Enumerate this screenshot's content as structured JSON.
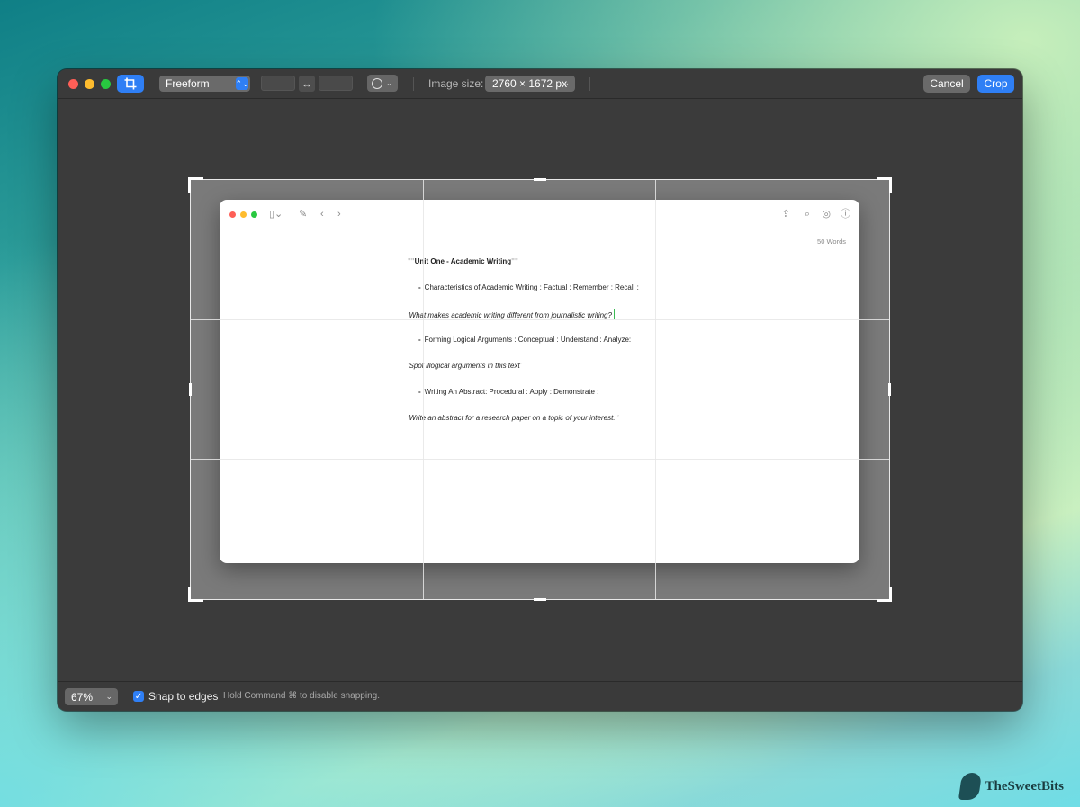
{
  "toolbar": {
    "aspect_popup": "Freeform",
    "aspect_stepper_icon": "⌃⌄",
    "swap_icon": "↔",
    "image_size_label": "Image size:",
    "image_size_value": "2760 × 1672 px",
    "cancel_label": "Cancel",
    "crop_label": "Crop"
  },
  "note": {
    "word_count": "50 Words",
    "lines": [
      {
        "prefix": "\"\"",
        "text": "Unit One - Academic Writing",
        "suffix": "\"\""
      },
      {
        "bullet": "-",
        "text": "Characteristics of Academic Writing : Factual : Remember : Recall :"
      },
      {
        "prefix": "'",
        "text": "What makes academic writing different from journalistic writing?"
      },
      {
        "bullet": "-",
        "text": "Forming Logical Arguments : Conceptual : Understand :  Analyze:"
      },
      {
        "prefix": "'",
        "text": "Spot illogical arguments in this text",
        "suffix": "'"
      },
      {
        "bullet": "-",
        "text": "Writing An Abstract: Procedural : Apply : Demonstrate :"
      },
      {
        "prefix": "'",
        "text": "Write an abstract for a research paper on a topic of your interest. ",
        "suffix": "'"
      }
    ]
  },
  "bottombar": {
    "zoom_value": "67%",
    "snap_label": "Snap to edges",
    "snap_hint": "Hold Command ⌘ to disable snapping."
  },
  "brand": {
    "name": "TheSweetBits"
  },
  "colors": {
    "accent": "#2f7ff5",
    "window_bg": "#3c3c3c",
    "cursor": "#3cba54"
  }
}
